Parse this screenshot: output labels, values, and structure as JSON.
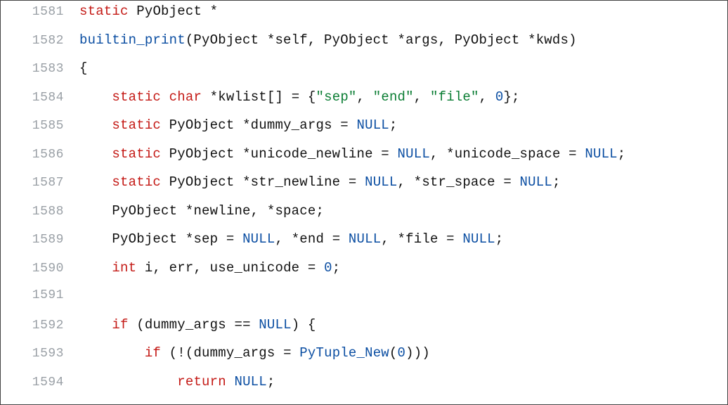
{
  "editor": {
    "lines": [
      {
        "num": "1581",
        "tokens": [
          {
            "t": "kw",
            "v": "static"
          },
          {
            "t": "sp",
            "v": " "
          },
          {
            "t": "plain",
            "v": "PyObject *"
          }
        ]
      },
      {
        "num": "1582",
        "tokens": [
          {
            "t": "fn",
            "v": "builtin_print"
          },
          {
            "t": "plain",
            "v": "(PyObject *self, PyObject *args, PyObject *kwds)"
          }
        ]
      },
      {
        "num": "1583",
        "tokens": [
          {
            "t": "plain",
            "v": "{"
          }
        ]
      },
      {
        "num": "1584",
        "tokens": [
          {
            "t": "indent",
            "v": "    "
          },
          {
            "t": "kw",
            "v": "static"
          },
          {
            "t": "sp",
            "v": " "
          },
          {
            "t": "kw",
            "v": "char"
          },
          {
            "t": "plain",
            "v": " *kwlist[] = {"
          },
          {
            "t": "str",
            "v": "\"sep\""
          },
          {
            "t": "plain",
            "v": ", "
          },
          {
            "t": "str",
            "v": "\"end\""
          },
          {
            "t": "plain",
            "v": ", "
          },
          {
            "t": "str",
            "v": "\"file\""
          },
          {
            "t": "plain",
            "v": ", "
          },
          {
            "t": "num",
            "v": "0"
          },
          {
            "t": "plain",
            "v": "};"
          }
        ]
      },
      {
        "num": "1585",
        "tokens": [
          {
            "t": "indent",
            "v": "    "
          },
          {
            "t": "kw",
            "v": "static"
          },
          {
            "t": "plain",
            "v": " PyObject *dummy_args = "
          },
          {
            "t": "null",
            "v": "NULL"
          },
          {
            "t": "plain",
            "v": ";"
          }
        ]
      },
      {
        "num": "1586",
        "tokens": [
          {
            "t": "indent",
            "v": "    "
          },
          {
            "t": "kw",
            "v": "static"
          },
          {
            "t": "plain",
            "v": " PyObject *unicode_newline = "
          },
          {
            "t": "null",
            "v": "NULL"
          },
          {
            "t": "plain",
            "v": ", *unicode_space = "
          },
          {
            "t": "null",
            "v": "NULL"
          },
          {
            "t": "plain",
            "v": ";"
          }
        ]
      },
      {
        "num": "1587",
        "tokens": [
          {
            "t": "indent",
            "v": "    "
          },
          {
            "t": "kw",
            "v": "static"
          },
          {
            "t": "plain",
            "v": " PyObject *str_newline = "
          },
          {
            "t": "null",
            "v": "NULL"
          },
          {
            "t": "plain",
            "v": ", *str_space = "
          },
          {
            "t": "null",
            "v": "NULL"
          },
          {
            "t": "plain",
            "v": ";"
          }
        ]
      },
      {
        "num": "1588",
        "tokens": [
          {
            "t": "indent",
            "v": "    "
          },
          {
            "t": "plain",
            "v": "PyObject *newline, *space;"
          }
        ]
      },
      {
        "num": "1589",
        "tokens": [
          {
            "t": "indent",
            "v": "    "
          },
          {
            "t": "plain",
            "v": "PyObject *sep = "
          },
          {
            "t": "null",
            "v": "NULL"
          },
          {
            "t": "plain",
            "v": ", *end = "
          },
          {
            "t": "null",
            "v": "NULL"
          },
          {
            "t": "plain",
            "v": ", *file = "
          },
          {
            "t": "null",
            "v": "NULL"
          },
          {
            "t": "plain",
            "v": ";"
          }
        ]
      },
      {
        "num": "1590",
        "tokens": [
          {
            "t": "indent",
            "v": "    "
          },
          {
            "t": "kw",
            "v": "int"
          },
          {
            "t": "plain",
            "v": " i, err, use_unicode = "
          },
          {
            "t": "num",
            "v": "0"
          },
          {
            "t": "plain",
            "v": ";"
          }
        ]
      },
      {
        "num": "1591",
        "tokens": []
      },
      {
        "num": "1592",
        "tokens": [
          {
            "t": "indent",
            "v": "    "
          },
          {
            "t": "kw",
            "v": "if"
          },
          {
            "t": "plain",
            "v": " (dummy_args == "
          },
          {
            "t": "null",
            "v": "NULL"
          },
          {
            "t": "plain",
            "v": ") {"
          }
        ]
      },
      {
        "num": "1593",
        "tokens": [
          {
            "t": "indent",
            "v": "        "
          },
          {
            "t": "kw",
            "v": "if"
          },
          {
            "t": "plain",
            "v": " (!(dummy_args = "
          },
          {
            "t": "fn",
            "v": "PyTuple_New"
          },
          {
            "t": "plain",
            "v": "("
          },
          {
            "t": "num",
            "v": "0"
          },
          {
            "t": "plain",
            "v": ")))"
          }
        ]
      },
      {
        "num": "1594",
        "tokens": [
          {
            "t": "indent",
            "v": "            "
          },
          {
            "t": "kw",
            "v": "return"
          },
          {
            "t": "plain",
            "v": " "
          },
          {
            "t": "null",
            "v": "NULL"
          },
          {
            "t": "plain",
            "v": ";"
          }
        ]
      }
    ],
    "cursor_line_index": 4
  }
}
